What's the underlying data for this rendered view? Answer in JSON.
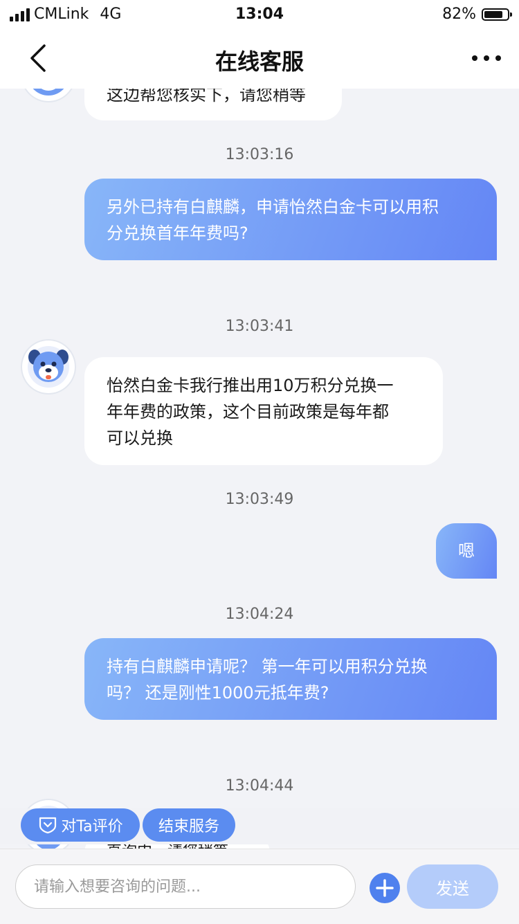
{
  "status_bar": {
    "carrier": "CMLink",
    "network": "4G",
    "time": "13:04",
    "battery": "82%"
  },
  "header": {
    "title": "在线客服",
    "back_icon": "chevron-left-icon",
    "more_icon": "more-dots-icon"
  },
  "messages": [
    {
      "sender": "agent",
      "text": "这边帮您核实下，请您稍等"
    },
    {
      "timestamp": "13:03:16"
    },
    {
      "sender": "user",
      "lines": [
        "另外已持有白麒麟，申请怡然白金卡可以用积",
        "分兑换首年年费吗?"
      ]
    },
    {
      "timestamp": "13:03:41"
    },
    {
      "sender": "agent",
      "lines": [
        "怡然白金卡我行推出用10万积分兑换一",
        "年年费的政策，这个目前政策是每年都",
        "可以兑换"
      ]
    },
    {
      "timestamp": "13:03:49"
    },
    {
      "sender": "user",
      "text": "嗯"
    },
    {
      "timestamp": "13:04:24"
    },
    {
      "sender": "user",
      "lines": [
        "持有白麒麟申请呢？ 第一年可以用积分兑换",
        "吗？ 还是刚性1000元抵年费?"
      ]
    },
    {
      "timestamp": "13:04:44"
    },
    {
      "sender": "agent",
      "text": "直询中，请您稍等"
    }
  ],
  "quick_actions": {
    "rate": "对Ta评价",
    "rate_icon": "rating-badge-icon",
    "end": "结束服务"
  },
  "input": {
    "placeholder": "请输入想要咨询的问题...",
    "add_icon": "plus-icon",
    "send_label": "发送"
  },
  "colors": {
    "accent": "#5b8cf0",
    "user_bubble_start": "#88b6f8",
    "user_bubble_end": "#6486f5",
    "send_disabled": "#b4ccfa",
    "background": "#f2f3f7"
  }
}
